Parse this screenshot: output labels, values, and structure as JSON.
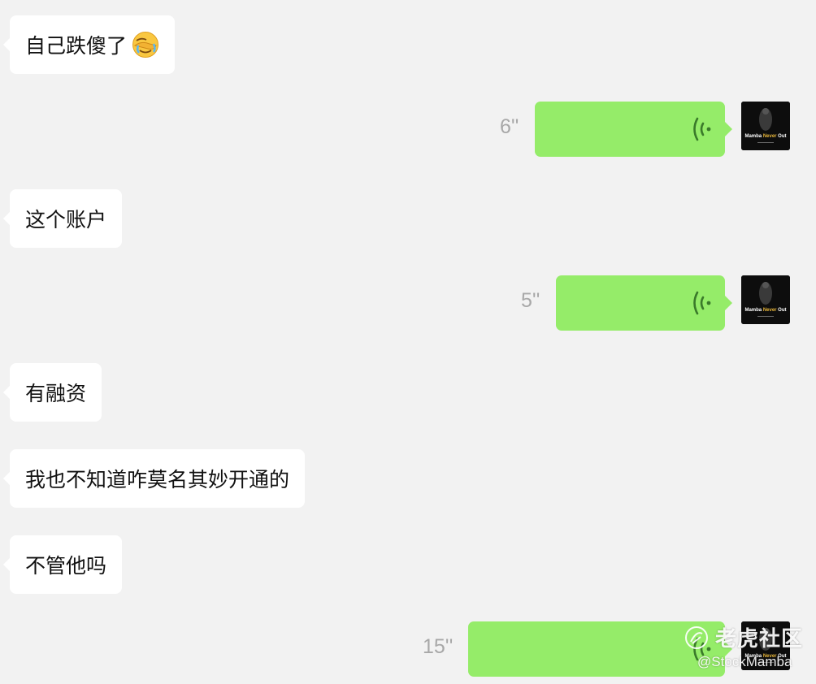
{
  "messages": {
    "m1": {
      "text": "自己跌傻了",
      "emoji": "face-palm-crying-emoji"
    },
    "v1": {
      "duration": "6''"
    },
    "m2": {
      "text": "这个账户"
    },
    "v2": {
      "duration": "5''"
    },
    "m3": {
      "text": "有融资"
    },
    "m4": {
      "text": "我也不知道咋莫名其妙开通的"
    },
    "m5": {
      "text": "不管他吗"
    },
    "v3": {
      "duration": "15''"
    }
  },
  "avatar": {
    "caption_1": "Mamba",
    "caption_2": "Never",
    "caption_3": "Out"
  },
  "watermark": {
    "brand": "老虎社区",
    "handle": "@StockMamba"
  },
  "colors": {
    "background": "#f2f2f2",
    "incoming_bubble": "#ffffff",
    "outgoing_voice_bubble": "#95ec69",
    "duration_text": "#a8a8a8"
  }
}
